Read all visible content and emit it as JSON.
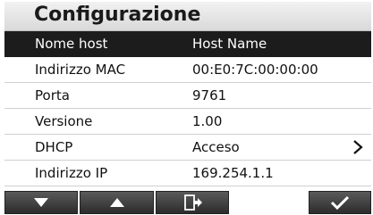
{
  "header": {
    "title": "Configurazione"
  },
  "rows": [
    {
      "label": "Nome host",
      "value": "Host Name",
      "selected": true
    },
    {
      "label": "Indirizzo MAC",
      "value": "00:E0:7C:00:00:00"
    },
    {
      "label": "Porta",
      "value": "9761"
    },
    {
      "label": "Versione",
      "value": "1.00"
    },
    {
      "label": "DHCP",
      "value": "Acceso",
      "has_submenu": true
    },
    {
      "label": "Indirizzo IP",
      "value": "169.254.1.1"
    }
  ],
  "toolbar": {
    "buttons": [
      {
        "icon": "arrow-down-icon"
      },
      {
        "icon": "arrow-up-icon"
      },
      {
        "icon": "exit-icon"
      },
      {
        "icon": "checkmark-icon"
      }
    ]
  },
  "colors": {
    "selected_row_bg": "#1c1c1c",
    "button_bg": "#3a3a3a"
  }
}
